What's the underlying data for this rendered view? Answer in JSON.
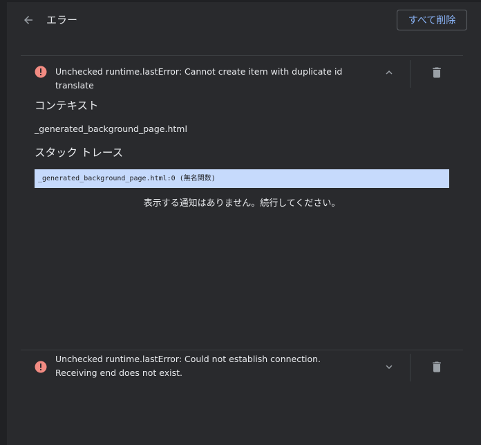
{
  "header": {
    "back_icon": "arrow-back-icon",
    "title": "エラー",
    "clear_all_label": "すべて削除"
  },
  "errors": [
    {
      "message": "Unchecked runtime.lastError: Cannot create item with duplicate id translate",
      "expanded": true,
      "icon": "error-circle-icon",
      "chevron_icon": "chevron-up-icon",
      "delete_icon": "trash-icon"
    },
    {
      "message": "Unchecked runtime.lastError: Could not establish connection. Receiving end does not exist.",
      "expanded": false,
      "icon": "error-circle-icon",
      "chevron_icon": "chevron-down-icon",
      "delete_icon": "trash-icon"
    }
  ],
  "details": {
    "context_title": "コンテキスト",
    "context_file": "_generated_background_page.html",
    "stack_title": "スタック トレース",
    "stack_line": "_generated_background_page.html:0 (無名関数)",
    "no_notice": "表示する通知はありません。続行してください。"
  },
  "colors": {
    "background": "#292a2d",
    "error_icon": "#f28b82",
    "accent": "#8ab4f8",
    "stack_highlight": "#c6dafc"
  }
}
